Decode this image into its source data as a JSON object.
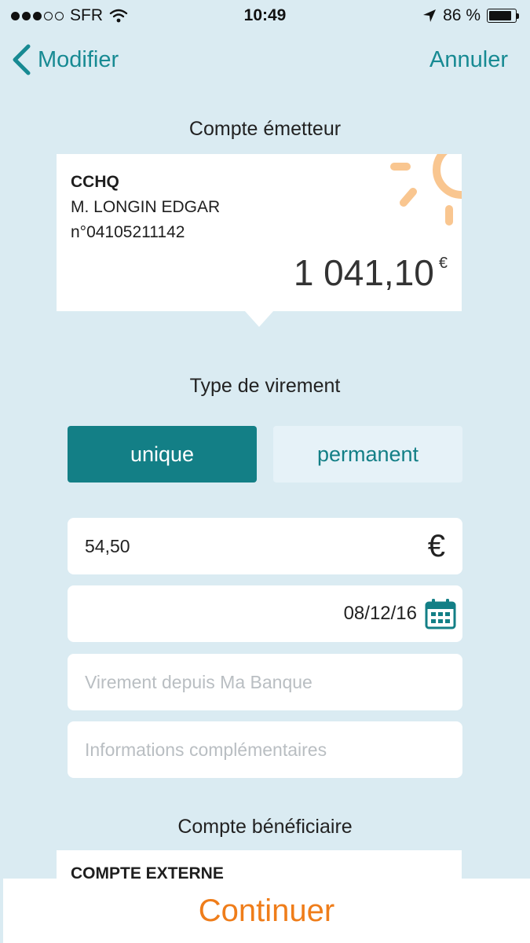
{
  "status_bar": {
    "carrier": "SFR",
    "time": "10:49",
    "battery": "86 %",
    "signal_bars_on": 3,
    "signal_bars_total": 5
  },
  "nav": {
    "back_label": "Modifier",
    "cancel_label": "Annuler"
  },
  "source_account": {
    "section_title": "Compte émetteur",
    "code": "CCHQ",
    "holder": "M. LONGIN EDGAR",
    "number": "n°04105211142",
    "balance": "1 041,10",
    "currency": "€"
  },
  "transfer_type": {
    "section_title": "Type de virement",
    "options": [
      "unique",
      "permanent"
    ],
    "selected": "unique"
  },
  "form": {
    "amount_value": "54,50",
    "amount_currency": "€",
    "date_value": "08/12/16",
    "label_placeholder": "Virement depuis Ma Banque",
    "info_placeholder": "Informations complémentaires"
  },
  "beneficiary": {
    "section_title": "Compte bénéficiaire",
    "name": "COMPTE EXTERNE"
  },
  "footer": {
    "continue_label": "Continuer"
  },
  "colors": {
    "background": "#daebf2",
    "accent": "#137f86",
    "link": "#178a93",
    "cta": "#ef7d1a",
    "sun": "#f9c690"
  },
  "icons": [
    "signal-icon",
    "wifi-icon",
    "location-arrow-icon",
    "battery-icon",
    "chevron-left-icon",
    "sun-icon",
    "euro-icon",
    "calendar-icon"
  ]
}
